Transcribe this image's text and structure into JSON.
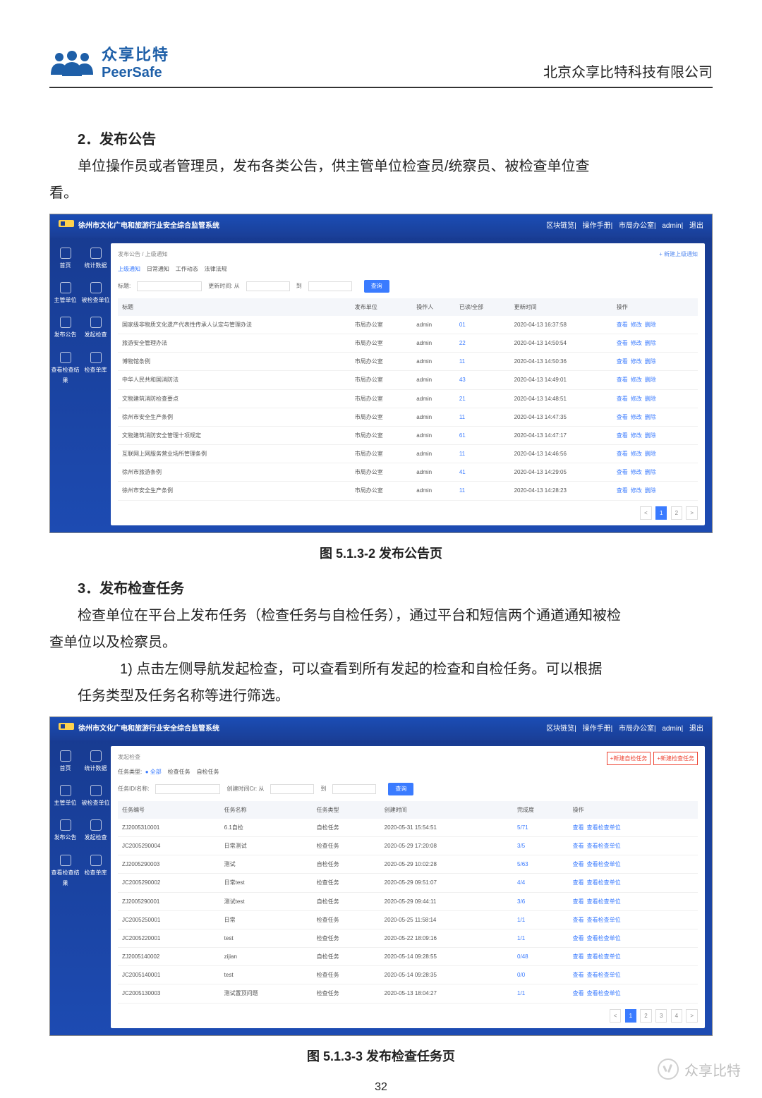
{
  "header": {
    "logo_cn": "众享比特",
    "logo_en": "PeerSafe",
    "company": "北京众享比特科技有限公司"
  },
  "doc": {
    "sec2": {
      "title": "2．发布公告",
      "desc_line1": "单位操作员或者管理员，发布各类公告，供主管单位检查员/统察员、被检查单位查",
      "desc_line2": "看。"
    },
    "fig1_caption": "图 5.1.3-2 发布公告页",
    "sec3": {
      "title": "3．发布检查任务",
      "desc_line1": "检查单位在平台上发布任务（检查任务与自检任务），通过平台和短信两个通道通知被检",
      "desc_line2": "查单位以及检察员。",
      "item1_line1": "1) 点击左侧导航发起检查，可以查看到所有发起的检查和自检任务。可以根据",
      "item1_line2": "任务类型及任务名称等进行筛选。"
    },
    "fig2_caption": "图 5.1.3-3 发布检查任务页",
    "page_num": "32"
  },
  "watermark": "众享比特",
  "shot1": {
    "app_title": "徐州市文化广电和旅游行业安全综合监管系统",
    "top_links": [
      "区块链览",
      "操作手册",
      "市局办公室",
      "admin",
      "退出"
    ],
    "sidebar": [
      "首页",
      "统计数据",
      "主管单位",
      "被检查单位",
      "发布公告",
      "发起检查",
      "查看检查结果",
      "检查单库"
    ],
    "breadcrumb": "发布公告 / 上级通知",
    "add_btn": "+ 新建上级通知",
    "tabs": [
      "上级通知",
      "日常通知",
      "工作动态",
      "法律法规"
    ],
    "filter": {
      "title_label": "标题:",
      "time_label": "更新时间: 从",
      "to": "到",
      "query": "查询"
    },
    "cols": [
      "标题",
      "发布单位",
      "操作人",
      "已读/全部",
      "更新时间",
      "操作"
    ],
    "rows": [
      {
        "title": "国家级非物质文化遗产代表性传承人认定与管理办法",
        "unit": "市局办公室",
        "op": "admin",
        "read": "01",
        "time": "2020-04-13 16:37:58"
      },
      {
        "title": "旅游安全管理办法",
        "unit": "市局办公室",
        "op": "admin",
        "read": "22",
        "time": "2020-04-13 14:50:54"
      },
      {
        "title": "博物馆条例",
        "unit": "市局办公室",
        "op": "admin",
        "read": "11",
        "time": "2020-04-13 14:50:36"
      },
      {
        "title": "中华人民共和国消防法",
        "unit": "市局办公室",
        "op": "admin",
        "read": "43",
        "time": "2020-04-13 14:49:01"
      },
      {
        "title": "文物建筑消防检查要点",
        "unit": "市局办公室",
        "op": "admin",
        "read": "21",
        "time": "2020-04-13 14:48:51"
      },
      {
        "title": "徐州市安全生产条例",
        "unit": "市局办公室",
        "op": "admin",
        "read": "11",
        "time": "2020-04-13 14:47:35"
      },
      {
        "title": "文物建筑消防安全管理十项规定",
        "unit": "市局办公室",
        "op": "admin",
        "read": "61",
        "time": "2020-04-13 14:47:17"
      },
      {
        "title": "互联网上网服务营业场所管理条例",
        "unit": "市局办公室",
        "op": "admin",
        "read": "11",
        "time": "2020-04-13 14:46:56"
      },
      {
        "title": "徐州市旅游条例",
        "unit": "市局办公室",
        "op": "admin",
        "read": "41",
        "time": "2020-04-13 14:29:05"
      },
      {
        "title": "徐州市安全生产条例",
        "unit": "市局办公室",
        "op": "admin",
        "read": "11",
        "time": "2020-04-13 14:28:23"
      }
    ],
    "row_ops": [
      "查看",
      "修改",
      "删除"
    ],
    "pager": {
      "cur": "1",
      "next": "2"
    }
  },
  "shot2": {
    "app_title": "徐州市文化广电和旅游行业安全综合监管系统",
    "top_links": [
      "区块链览",
      "操作手册",
      "市局办公室",
      "admin",
      "退出"
    ],
    "sidebar": [
      "首页",
      "统计数据",
      "主管单位",
      "被检查单位",
      "发布公告",
      "发起检查",
      "查看检查结果",
      "检查单库"
    ],
    "breadcrumb": "发起检查",
    "add_btns": [
      "+新建检查任务",
      "+新建自检任务"
    ],
    "type_label": "任务类型:",
    "types": [
      "● 全部",
      "检查任务",
      "自检任务"
    ],
    "filter": {
      "id_label": "任务ID/名称:",
      "time_label": "创建时间Cr: 从",
      "to": "到",
      "query": "查询"
    },
    "cols": [
      "任务编号",
      "任务名称",
      "任务类型",
      "创建时间",
      "完成度",
      "操作"
    ],
    "rows": [
      {
        "id": "ZJ2005310001",
        "name": "6.1自检",
        "type": "自检任务",
        "time": "2020-05-31 15:54:51",
        "done": "5/71"
      },
      {
        "id": "JC2005290004",
        "name": "日常测试",
        "type": "检查任务",
        "time": "2020-05-29 17:20:08",
        "done": "3/5"
      },
      {
        "id": "ZJ2005290003",
        "name": "测试",
        "type": "自检任务",
        "time": "2020-05-29 10:02:28",
        "done": "5/63"
      },
      {
        "id": "JC2005290002",
        "name": "日常test",
        "type": "检查任务",
        "time": "2020-05-29 09:51:07",
        "done": "4/4"
      },
      {
        "id": "ZJ2005290001",
        "name": "测试test",
        "type": "自检任务",
        "time": "2020-05-29 09:44:11",
        "done": "3/6"
      },
      {
        "id": "JC2005250001",
        "name": "日常",
        "type": "检查任务",
        "time": "2020-05-25 11:58:14",
        "done": "1/1"
      },
      {
        "id": "JC2005220001",
        "name": "test",
        "type": "检查任务",
        "time": "2020-05-22 18:09:16",
        "done": "1/1"
      },
      {
        "id": "ZJ2005140002",
        "name": "zijian",
        "type": "自检任务",
        "time": "2020-05-14 09:28:55",
        "done": "0/48"
      },
      {
        "id": "JC2005140001",
        "name": "test",
        "type": "检查任务",
        "time": "2020-05-14 09:28:35",
        "done": "0/0"
      },
      {
        "id": "JC2005130003",
        "name": "测试置顶问题",
        "type": "检查任务",
        "time": "2020-05-13 18:04:27",
        "done": "1/1"
      }
    ],
    "row_ops": [
      "查看",
      "查看检查单位"
    ],
    "pager": {
      "p1": "1",
      "p2": "2",
      "p3": "3",
      "p4": "4"
    }
  }
}
